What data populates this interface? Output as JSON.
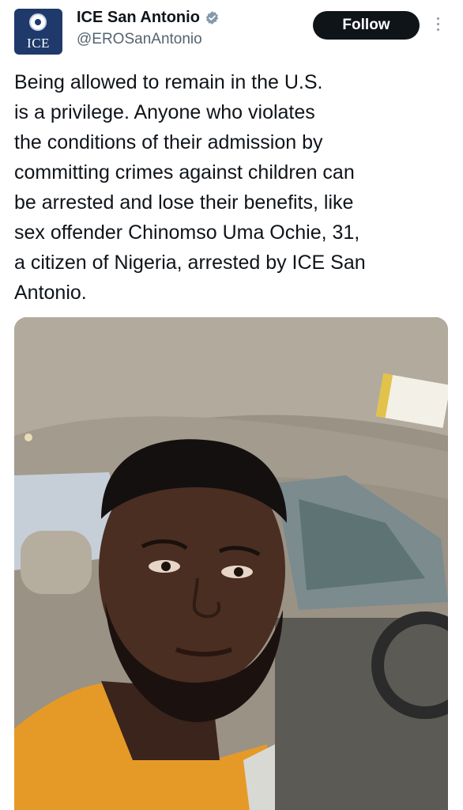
{
  "account": {
    "display_name": "ICE San Antonio",
    "handle": "@EROSanAntonio",
    "avatar_text": "ICE",
    "verified": true
  },
  "actions": {
    "follow_label": "Follow"
  },
  "tweet": {
    "lines": [
      "Being allowed to remain in the U.S.",
      "is a privilege. Anyone who violates",
      "the conditions of their admission by",
      "committing crimes against children can",
      "be arrested and lose their benefits, like",
      "sex offender Chinomso Uma Ochie, 31,",
      "a citizen of Nigeria, arrested by ICE San",
      "Antonio."
    ]
  },
  "media": {
    "kind": "photo"
  },
  "icons": {
    "verified": "verified-badge-icon",
    "more": "more-options-icon"
  },
  "colors": {
    "follow_bg": "#0f1419",
    "handle_text": "#536471",
    "verified_badge": "#829aab",
    "avatar_bg": "#1f3a6a"
  }
}
